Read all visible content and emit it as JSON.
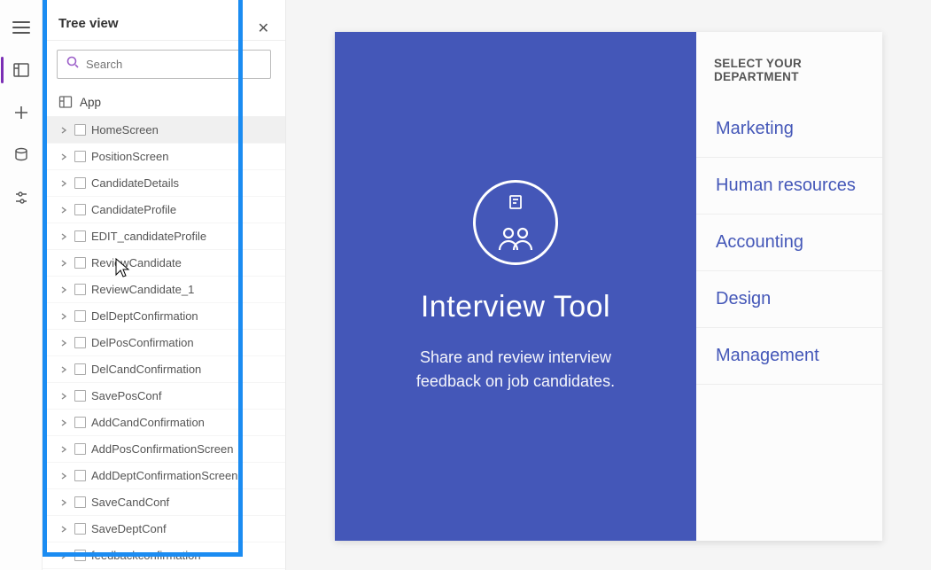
{
  "panel": {
    "title": "Tree view",
    "search_placeholder": "Search",
    "app_root_label": "App"
  },
  "tree_items": [
    {
      "label": "HomeScreen",
      "selected": true,
      "has_more": true
    },
    {
      "label": "PositionScreen"
    },
    {
      "label": "CandidateDetails"
    },
    {
      "label": "CandidateProfile"
    },
    {
      "label": "EDIT_candidateProfile"
    },
    {
      "label": "ReviewCandidate",
      "has_more": true
    },
    {
      "label": "ReviewCandidate_1"
    },
    {
      "label": "DelDeptConfirmation"
    },
    {
      "label": "DelPosConfirmation"
    },
    {
      "label": "DelCandConfirmation"
    },
    {
      "label": "SavePosConf"
    },
    {
      "label": "AddCandConfirmation"
    },
    {
      "label": "AddPosConfirmationScreen"
    },
    {
      "label": "AddDeptConfirmationScreen"
    },
    {
      "label": "SaveCandConf"
    },
    {
      "label": "SaveDeptConf"
    },
    {
      "label": "feedbackconfirmation"
    }
  ],
  "preview": {
    "title": "Interview Tool",
    "subtitle": "Share and review interview feedback on job candidates.",
    "dept_header": "SELECT YOUR DEPARTMENT",
    "departments": [
      "Marketing",
      "Human resources",
      "Accounting",
      "Design",
      "Management"
    ]
  }
}
